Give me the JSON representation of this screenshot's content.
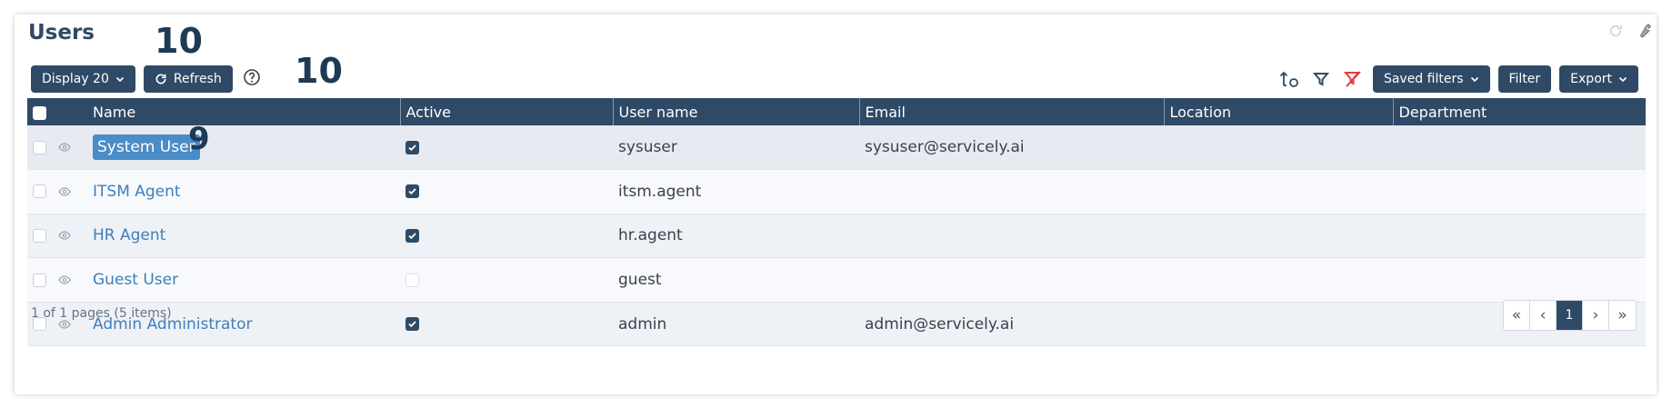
{
  "page": {
    "title": "Users"
  },
  "toolbar": {
    "display_label": "Display 20",
    "refresh_label": "Refresh",
    "saved_filters_label": "Saved filters",
    "filter_label": "Filter",
    "export_label": "Export"
  },
  "annotations": {
    "refresh_count": "10",
    "help_count": "10",
    "row_marker": "9"
  },
  "table": {
    "headers": [
      "Name",
      "Active",
      "User name",
      "Email",
      "Location",
      "Department"
    ],
    "rows": [
      {
        "name": "System User",
        "active": true,
        "username": "sysuser",
        "email": "sysuser@servicely.ai",
        "location": "",
        "department": ""
      },
      {
        "name": "ITSM Agent",
        "active": true,
        "username": "itsm.agent",
        "email": "",
        "location": "",
        "department": ""
      },
      {
        "name": "HR Agent",
        "active": true,
        "username": "hr.agent",
        "email": "",
        "location": "",
        "department": ""
      },
      {
        "name": "Guest User",
        "active": false,
        "username": "guest",
        "email": "",
        "location": "",
        "department": ""
      },
      {
        "name": "Admin Administrator",
        "active": true,
        "username": "admin",
        "email": "admin@servicely.ai",
        "location": "",
        "department": ""
      }
    ]
  },
  "footer": {
    "summary": "1 of 1 pages (5 items)"
  },
  "pagination": {
    "first": "«",
    "prev": "‹",
    "current": "1",
    "next": "›",
    "last": "»"
  },
  "colors": {
    "header_bg": "#2f4a66",
    "link": "#3f7fba",
    "selected": "#4a8cc7",
    "clear_filter": "#e23b3b"
  },
  "icons": [
    "refresh-icon",
    "wrench-icon",
    "help-icon",
    "sort-icon",
    "filter-icon",
    "clear-filter-icon",
    "eye-icon",
    "chevron-down-icon"
  ]
}
